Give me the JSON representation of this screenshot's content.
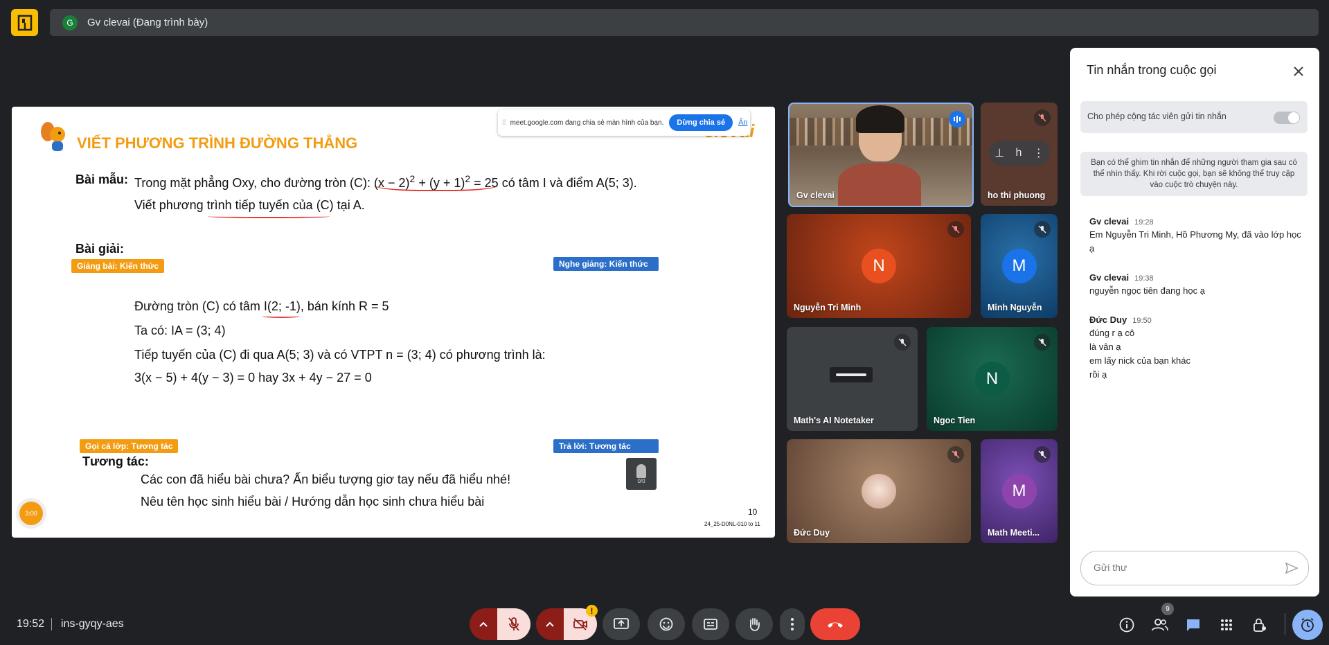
{
  "header": {
    "presenter_initial": "G",
    "presenter_label": "Gv clevai (Đang trình bày)"
  },
  "share_banner": {
    "text": "meet.google.com đang chia sẻ màn hình của bạn.",
    "stop_label": "Dừng chia sẻ",
    "hide_label": "Ẩn"
  },
  "slide": {
    "brand": "clevai",
    "title": "VIẾT PHƯƠNG TRÌNH ĐƯỜNG THẲNG",
    "sample_label": "Bài mẫu:",
    "problem_line1_a": "Trong mặt phẳng Oxy, cho đường tròn (C): ",
    "problem_eq": "(x − 2)",
    "problem_eq2": " + (y + 1)",
    "problem_eq3": " = 25",
    "exp": "2",
    "problem_line1_b": " có tâm I và điểm A(5; 3).",
    "problem_line2": "Viết phương trình tiếp tuyến của (C) tại A.",
    "solution_label": "Bài giải:",
    "tag_lecture": "Giảng bài: Kiến thức",
    "tag_listen": "Nghe giảng: Kiến thức",
    "sol_line1": "Đường tròn (C) có tâm I(2; -1), bán kính R = 5",
    "sol_line2": "Ta có: IA = (3; 4)",
    "sol_line3": "Tiếp tuyến của (C) đi qua A(5; 3) và có VTPT n = (3; 4) có phương trình là:",
    "sol_line4": "3(x − 5) + 4(y − 3) = 0 hay 3x + 4y − 27 = 0",
    "tag_call": "Gọi cả lớp: Tương tác",
    "tag_answer": "Trả lời: Tương tác",
    "interact_label": "Tương tác:",
    "interact_line1": "Các con đã hiểu bài chưa? Ấn biểu tượng giơ tay nếu đã hiểu nhé!",
    "interact_line2": "Nêu tên học sinh hiểu bài / Hướng dẫn học sinh chưa hiểu bài",
    "timer": "3:00",
    "page_number": "10",
    "code": "24_25-D0NL-010 to 11",
    "widget_count": "0/0"
  },
  "participants": [
    {
      "name": "Gv clevai",
      "initial": "",
      "color": "#6d5a48"
    },
    {
      "name": "ho thi phuong",
      "initial": "",
      "color": "#5a3a2e"
    },
    {
      "name": "Nguyễn Tri Minh",
      "initial": "N",
      "color": "#e8501f"
    },
    {
      "name": "Minh Nguyễn",
      "initial": "M",
      "color": "#1a73e8"
    },
    {
      "name": "Math's AI Notetaker",
      "initial": "",
      "color": "#3c4043"
    },
    {
      "name": "Ngoc Tien",
      "initial": "N",
      "color": "#0d5c46"
    },
    {
      "name": "Đức Duy",
      "initial": "",
      "color": "#8a6a55"
    },
    {
      "name": "Math Meeti...",
      "initial": "M",
      "color": "#8e44ad"
    }
  ],
  "chat": {
    "title": "Tin nhắn trong cuộc gọi",
    "allow_label": "Cho phép cộng tác viên gửi tin nhắn",
    "notice": "Bạn có thể ghim tin nhắn để những người tham gia sau có thể nhìn thấy. Khi rời cuộc gọi, bạn sẽ không thể truy cập vào cuộc trò chuyện này.",
    "messages": [
      {
        "sender": "Gv clevai",
        "time": "19:28",
        "lines": [
          "Em Nguyễn Tri Minh, Hồ Phương My, đã vào lớp học",
          "ạ"
        ]
      },
      {
        "sender": "Gv clevai",
        "time": "19:38",
        "lines": [
          "nguyễn ngọc tiên đang học ạ"
        ]
      },
      {
        "sender": "Đức Duy",
        "time": "19:50",
        "lines": [
          "đúng r ạ cô",
          "là vân ạ",
          "em lấy nick của bạn khác",
          "rồi ạ"
        ]
      }
    ],
    "input_placeholder": "Gửi thư"
  },
  "footer": {
    "time": "19:52",
    "meeting_code": "ins-gyqy-aes",
    "people_count": "9"
  }
}
